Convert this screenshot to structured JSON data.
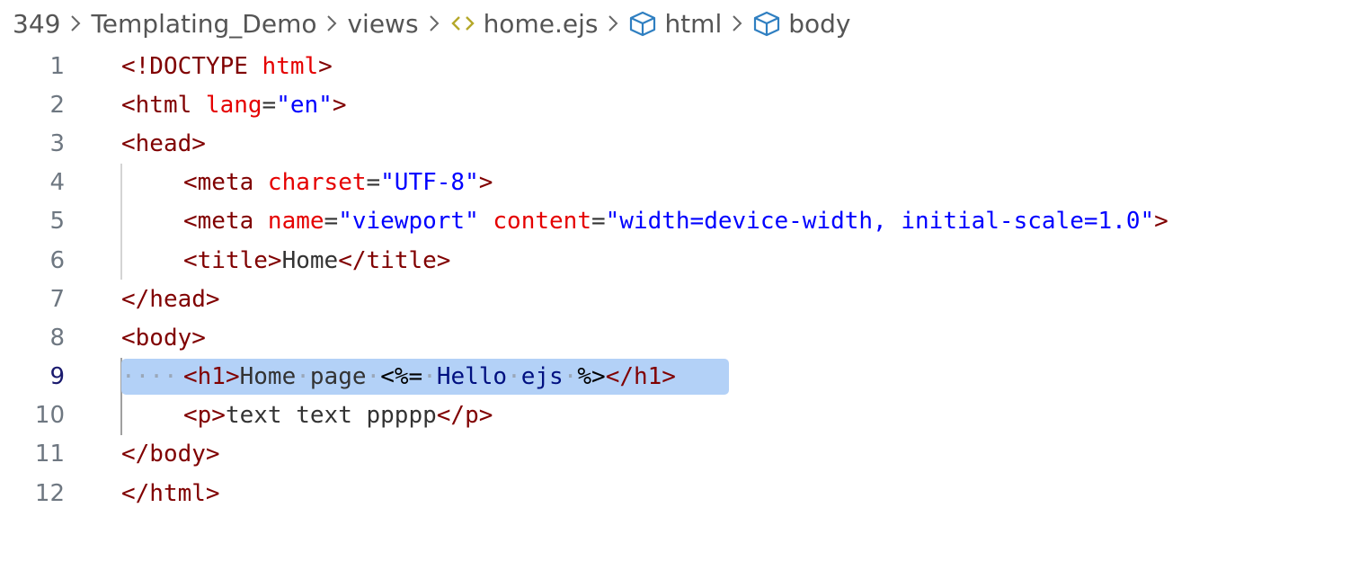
{
  "breadcrumb": {
    "items": [
      {
        "label": "349"
      },
      {
        "label": "Templating_Demo"
      },
      {
        "label": "views"
      },
      {
        "label": "home.ejs",
        "icon": "ejs-file-icon"
      },
      {
        "label": "html",
        "icon": "element-cube-icon"
      },
      {
        "label": "body",
        "icon": "element-cube-icon"
      }
    ]
  },
  "colors": {
    "tag": "#800000",
    "attribute": "#e50000",
    "string": "#0000ff",
    "text": "#333333",
    "selection": "#b3d1f7",
    "ejs_icon": "#b5a82a",
    "cube_icon": "#2f7fc1"
  },
  "editor": {
    "active_line": 9,
    "lines": [
      {
        "number": "1",
        "t1": "<!DOCTYPE ",
        "t2": "html",
        "t3": ">"
      },
      {
        "number": "2",
        "t1": "<html ",
        "t2": "lang",
        "t3": "=",
        "t4": "\"en\"",
        "t5": ">"
      },
      {
        "number": "3",
        "t1": "<head>"
      },
      {
        "number": "4",
        "t1": "<meta ",
        "t2": "charset",
        "t3": "=",
        "t4": "\"UTF-8\"",
        "t5": ">"
      },
      {
        "number": "5",
        "t1": "<meta ",
        "t2": "name",
        "t3": "=",
        "t4": "\"viewport\"",
        "t5": " ",
        "t6": "content",
        "t7": "=",
        "t8": "\"width=device-width, initial-scale=1.0\"",
        "t9": ">"
      },
      {
        "number": "6",
        "t1": "<title>",
        "t2": "Home",
        "t3": "</title>"
      },
      {
        "number": "7",
        "t1": "</head>"
      },
      {
        "number": "8",
        "t1": "<body>"
      },
      {
        "number": "9",
        "t1": "····",
        "t2": "<h1>",
        "t3": "Home",
        "t4": "·",
        "t5": "page",
        "t6": "·",
        "t7": "<%=",
        "t8": "·",
        "t9": "Hello",
        "t10": "·",
        "t11": "ejs",
        "t12": "·",
        "t13": "%>",
        "t14": "</h1>"
      },
      {
        "number": "10",
        "t1": "<p>",
        "t2": "text text ppppp",
        "t3": "</p>"
      },
      {
        "number": "11",
        "t1": "</body>"
      },
      {
        "number": "12",
        "t1": "</html>"
      }
    ]
  }
}
